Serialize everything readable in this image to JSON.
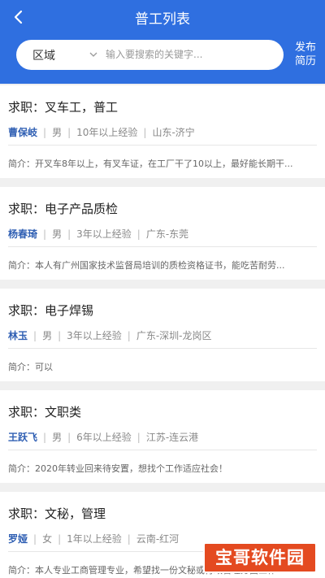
{
  "header": {
    "title": "普工列表",
    "back_icon": "chevron-left-icon",
    "publish_line1": "发布",
    "publish_line2": "简历"
  },
  "search": {
    "region": "区域",
    "placeholder": "输入要搜索的关键字..."
  },
  "labels": {
    "job_prefix": "求职：",
    "intro_prefix": "简介："
  },
  "items": [
    {
      "job": "叉车工，普工",
      "name": "曹保岐",
      "gender": "男",
      "experience": "10年以上经验",
      "location": "山东-济宁",
      "intro": "开叉车8年以上，有叉车证，在工厂干了10以上，最好能长期干..."
    },
    {
      "job": "电子产品质检",
      "name": "杨春琦",
      "gender": "男",
      "experience": "3年以上经验",
      "location": "广东-东莞",
      "intro": "本人有广州国家技术监督局培训的质检资格证书，能吃苦耐劳..."
    },
    {
      "job": "电子焊锡",
      "name": "林玉",
      "gender": "男",
      "experience": "3年以上经验",
      "location": "广东-深圳-龙岗区",
      "intro": "可以"
    },
    {
      "job": "文职类",
      "name": "王跃飞",
      "gender": "男",
      "experience": "6年以上经验",
      "location": "江苏-连云港",
      "intro": "2020年转业回来待安置，想找个工作适应社会！"
    },
    {
      "job": "文秘，管理",
      "name": "罗娅",
      "gender": "女",
      "experience": "1年以上经验",
      "location": "云南-红河",
      "intro": "本人专业工商管理专业，希望找一份文秘或行政管理方面工作..."
    }
  ],
  "watermark": "宝哥软件园",
  "colors": {
    "header": "#2f6fe0",
    "name": "#2f5fb3",
    "watermark": "#e44a20"
  }
}
